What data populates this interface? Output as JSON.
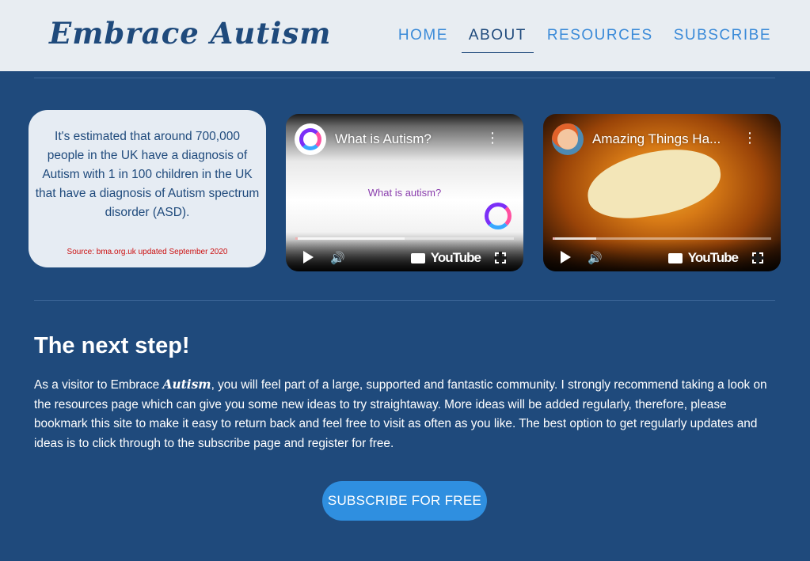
{
  "header": {
    "brand": "Embrace Autism",
    "nav": [
      "HOME",
      "ABOUT",
      "RESOURCES",
      "SUBSCRIBE"
    ],
    "active_nav": "ABOUT"
  },
  "stat_card": {
    "text": "It's estimated that around 700,000 people in the UK have a diagnosis of Autism with 1 in 100 children in the UK that have a diagnosis of Autism spectrum disorder (ASD).",
    "source": "Source: bma.org.uk updated September 2020"
  },
  "videos": [
    {
      "title": "What is Autism?",
      "center_text": "What is autism?",
      "brand": "YouTube",
      "played_fraction": 0.01,
      "buffered_fraction": 0.5
    },
    {
      "title": "Amazing Things Ha...",
      "brand": "YouTube",
      "played_fraction": 0.0,
      "buffered_fraction": 0.2
    }
  ],
  "next_step": {
    "title": "The next step!",
    "para_start": "As a visitor to Embrace ",
    "para_brand": "Autism",
    "para_rest": ", you will feel part of a large, supported and fantastic community. I strongly recommend taking a look on the resources page which can give you some new ideas to try straightaway. More ideas will be added regularly, therefore, please bookmark this site to make it easy to return back and feel free to visit as often as you like. The best option to get regularly updates and ideas is to click through to the subscribe page and register for free."
  },
  "cta": {
    "label": "SUBSCRIBE FOR FREE"
  },
  "colors": {
    "page_bg": "#1f4a7c",
    "header_bg": "#e8edf2",
    "accent": "#2f8fe0",
    "source_red": "#cc1111"
  }
}
